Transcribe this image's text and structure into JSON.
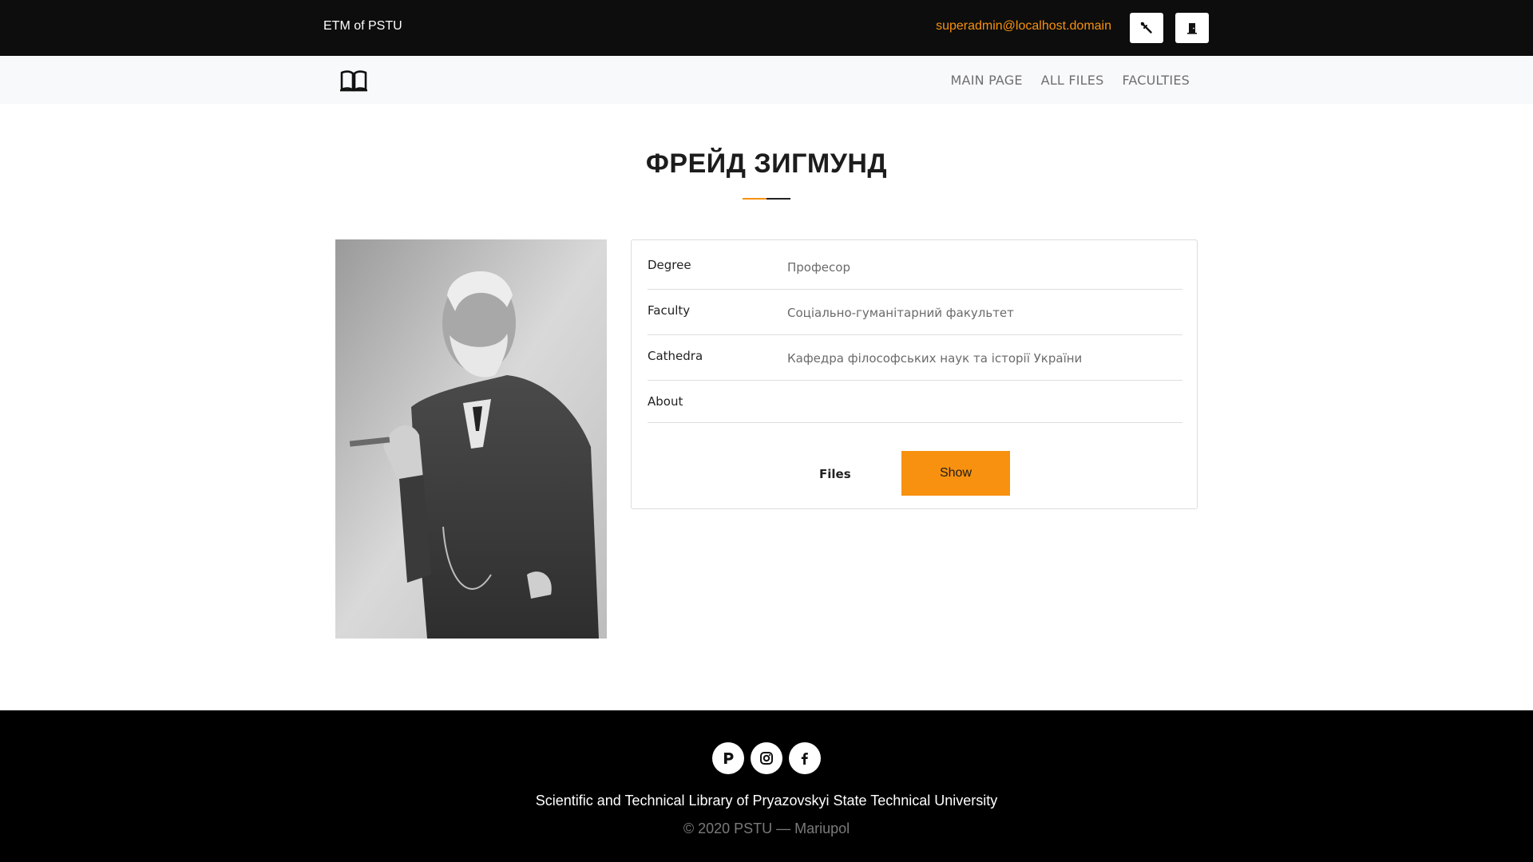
{
  "topbar": {
    "brand": "ETM of PSTU",
    "user_email": "superadmin@localhost.domain",
    "tools_icon": "wrench-icon",
    "exit_icon": "door-exit-icon"
  },
  "navbar": {
    "logo_icon": "open-book-icon",
    "links": [
      "MAIN PAGE",
      "ALL FILES",
      "FACULTIES"
    ]
  },
  "profile": {
    "name": "ФРЕЙД ЗИГМУНД",
    "photo": "black-and-white portrait photo",
    "fields": [
      {
        "label": "Degree",
        "value": "Професор"
      },
      {
        "label": "Faculty",
        "value": "Соціально-гуманітарний факультет"
      },
      {
        "label": "Cathedra",
        "value": "Кафедра філософських наук та історії України"
      },
      {
        "label": "About",
        "value": ""
      }
    ],
    "files_label": "Files",
    "show_button": "Show"
  },
  "footer": {
    "social_icons": [
      "p-logo-icon",
      "instagram-icon",
      "facebook-icon"
    ],
    "name": "Scientific and Technical Library of Pryazovskyi State Technical University",
    "copyright": "© 2020 PSTU — Mariupol"
  },
  "colors": {
    "accent": "#f7910f",
    "topbar_bg": "#0d0d0d",
    "navbar_bg": "#f8f9fa",
    "footer_bg": "#000000"
  }
}
